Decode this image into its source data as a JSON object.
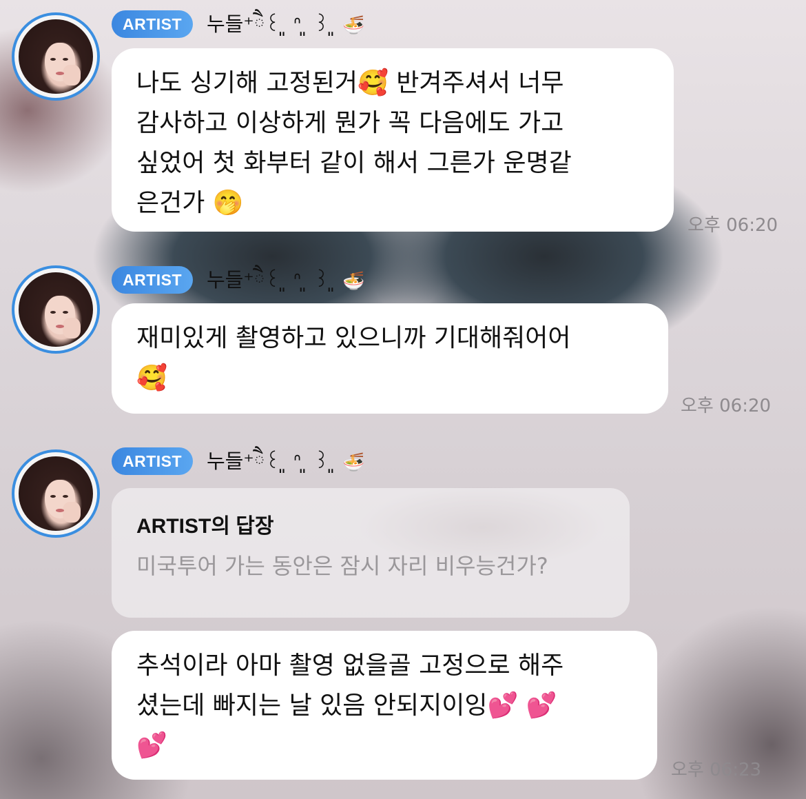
{
  "messages": [
    {
      "badge": "ARTIST",
      "nickname": "누들⁺ཻ꒰ ͈ ᐢ ͈ ꒱ ͈",
      "nick_emoji": "🍜",
      "text": "나도 싱기해 고정된거🥰 반겨주셔서 너무\n감사하고 이상하게 뭔가 꼭 다음에도 가고\n싶었어 첫 화부터 같이 해서 그른가 운명같\n은건가 🤭",
      "time": "오후 06:20"
    },
    {
      "badge": "ARTIST",
      "nickname": "누들⁺ཻ꒰ ͈ ᐢ ͈ ꒱ ͈",
      "nick_emoji": "🍜",
      "text": "재미있게 촬영하고 있으니까 기대해줘어어\n🥰",
      "time": "오후 06:20"
    },
    {
      "badge": "ARTIST",
      "nickname": "누들⁺ཻ꒰ ͈ ᐢ ͈ ꒱ ͈",
      "nick_emoji": "🍜",
      "reply_title": "ARTIST의 답장",
      "reply_quote": "미국투어 가는 동안은 잠시 자리 비우능건가?",
      "text": "추석이라 아마 촬영 없을골 고정으로 해주\n셨는데 빠지는 날 있음 안되지이잉💕 💕\n💕",
      "time": "오후 06:23"
    }
  ],
  "colors": {
    "badge": "#3b87e0",
    "avatar_ring": "#3a8ee0",
    "bubble": "#ffffff",
    "time_text": "#8e8a8e",
    "quote_text": "#9a979a"
  }
}
